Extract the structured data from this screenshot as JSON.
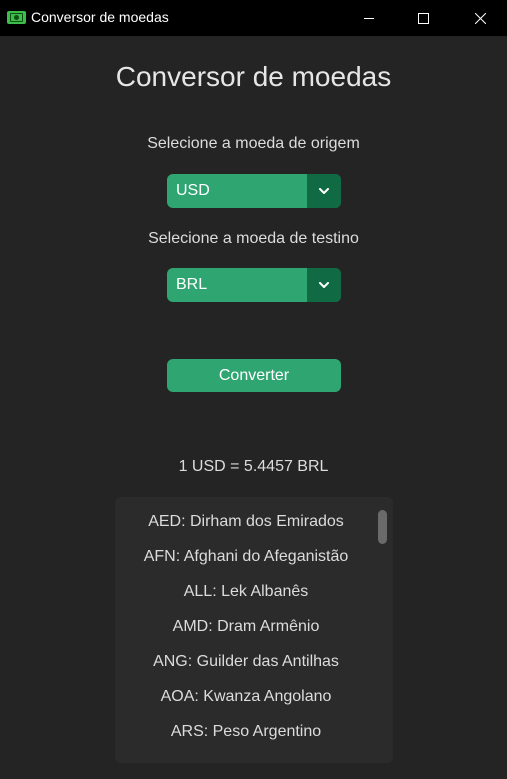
{
  "window": {
    "title": "Conversor de moedas",
    "icon": "money-bill-icon",
    "controls": [
      "minimize-icon",
      "maximize-icon",
      "close-icon"
    ]
  },
  "main": {
    "heading": "Conversor de moedas",
    "origin_label": "Selecione a moeda de origem",
    "origin_value": "USD",
    "dest_label": "Selecione a moeda de testino",
    "dest_value": "BRL",
    "convert_label": "Converter",
    "result": "1 USD = 5.4457 BRL"
  },
  "currencies": [
    "AED: Dirham dos Emirados",
    "AFN: Afghani do Afeganistão",
    "ALL: Lek Albanês",
    "AMD: Dram Armênio",
    "ANG: Guilder das Antilhas",
    "AOA: Kwanza Angolano",
    "ARS: Peso Argentino"
  ],
  "colors": {
    "background": "#242424",
    "titlebar": "#000000",
    "accent": "#2fa572",
    "accent_dark": "#106a43",
    "list_bg": "#2b2b2b",
    "text": "#dcdcdc"
  }
}
